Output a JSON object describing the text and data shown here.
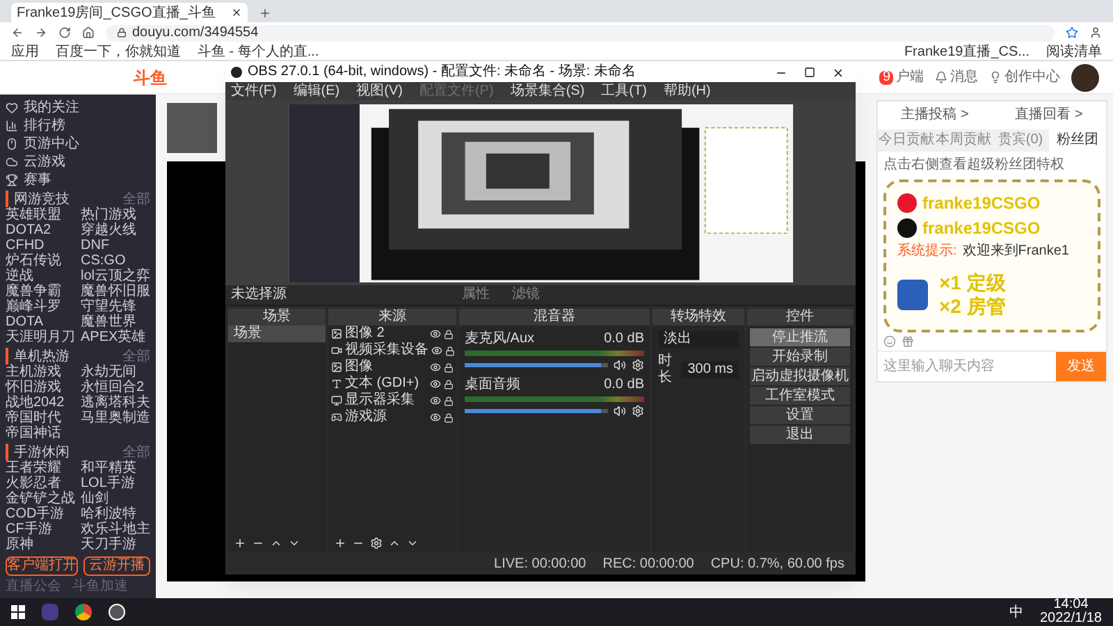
{
  "browser": {
    "tab_title": "Franke19房间_CSGO直播_斗鱼",
    "address": "douyu.com/3494554",
    "bookmarks": [
      "应用",
      "百度一下，你就知道",
      "斗鱼 - 每个人的直..."
    ],
    "bookmarks_right": [
      "Franke19直播_CS...",
      "阅读清单"
    ]
  },
  "site": {
    "logo": "斗鱼",
    "header_items": [
      "户端",
      "消息",
      "创作中心"
    ],
    "badge": "9"
  },
  "sidebar": {
    "nav": [
      {
        "label": "我的关注",
        "kind": "heart"
      },
      {
        "label": "排行榜",
        "kind": "rank"
      },
      {
        "label": "页游中心",
        "kind": "mouse"
      },
      {
        "label": "云游戏",
        "kind": "cloud"
      },
      {
        "label": "赛事",
        "kind": "trophy"
      }
    ],
    "sections": [
      {
        "title": "网游竞技",
        "more": "全部",
        "items": [
          "英雄联盟",
          "热门游戏",
          "DOTA2",
          "穿越火线",
          "CFHD",
          "DNF",
          "炉石传说",
          "CS:GO",
          "逆战",
          "lol云顶之弈",
          "魔兽争霸",
          "魔兽怀旧服",
          "巅峰斗罗",
          "守望先锋",
          "DOTA",
          "魔兽世界",
          "天涯明月刀",
          "APEX英雄"
        ]
      },
      {
        "title": "单机热游",
        "more": "全部",
        "items": [
          "主机游戏",
          "永劫无间",
          "怀旧游戏",
          "永恒回合2",
          "战地2042",
          "逃离塔科夫",
          "帝国时代",
          "马里奥制造",
          "帝国神话"
        ]
      },
      {
        "title": "手游休闲",
        "more": "全部",
        "items": [
          "王者荣耀",
          "和平精英",
          "火影忍者",
          "LOL手游",
          "金铲铲之战",
          "仙剑",
          "COD手游",
          "哈利波特",
          "CF手游",
          "欢乐斗地主",
          "原神",
          "天刀手游"
        ]
      }
    ],
    "buttons": [
      "客户端打开",
      "云游开播"
    ],
    "footer": [
      "直播公会",
      "斗鱼加速"
    ]
  },
  "obs": {
    "title": "OBS 27.0.1 (64-bit, windows) - 配置文件: 未命名 - 场景: 未命名",
    "menu": [
      {
        "label": "文件(F)",
        "disabled": false
      },
      {
        "label": "编辑(E)",
        "disabled": false
      },
      {
        "label": "视图(V)",
        "disabled": false
      },
      {
        "label": "配置文件(P)",
        "disabled": true
      },
      {
        "label": "场景集合(S)",
        "disabled": false
      },
      {
        "label": "工具(T)",
        "disabled": false
      },
      {
        "label": "帮助(H)",
        "disabled": false
      }
    ],
    "source_bar": {
      "label": "未选择源",
      "buttons": [
        "属性",
        "滤镜"
      ]
    },
    "docks": {
      "scenes": "场景",
      "sources": "来源",
      "mixer": "混音器",
      "transitions": "转场特效",
      "controls": "控件"
    },
    "scenes": [
      {
        "label": "场景",
        "selected": true
      }
    ],
    "sources": [
      {
        "label": "图像 2",
        "kind": "image"
      },
      {
        "label": "视频采集设备",
        "kind": "camera"
      },
      {
        "label": "图像",
        "kind": "image"
      },
      {
        "label": "文本 (GDI+)",
        "kind": "text"
      },
      {
        "label": "显示器采集",
        "kind": "monitor"
      },
      {
        "label": "游戏源",
        "kind": "game"
      }
    ],
    "mixer": [
      {
        "name": "麦克风/Aux",
        "reading": "0.0 dB",
        "level": 0.95
      },
      {
        "name": "桌面音频",
        "reading": "0.0 dB",
        "level": 0.95
      }
    ],
    "transition": {
      "value": "淡出",
      "duration_label": "时长",
      "duration": "300 ms"
    },
    "controls": [
      {
        "label": "停止推流",
        "active": true
      },
      {
        "label": "开始录制",
        "active": false
      },
      {
        "label": "启动虚拟摄像机",
        "active": false
      },
      {
        "label": "工作室模式",
        "active": false
      },
      {
        "label": "设置",
        "active": false
      },
      {
        "label": "退出",
        "active": false
      }
    ],
    "status": [
      "LIVE: 00:00:00",
      "REC: 00:00:00",
      "CPU: 0.7%, 60.00 fps"
    ]
  },
  "panel": {
    "links": [
      "主播投稿 >",
      "直播回看 >"
    ],
    "tabs": [
      {
        "label": "今日贡献",
        "selected": false
      },
      {
        "label": "本周贡献",
        "selected": false
      },
      {
        "label": "贵宾(0)",
        "selected": false
      },
      {
        "label": "粉丝团",
        "selected": true
      }
    ],
    "notice": "点击右侧查看超级粉丝团特权",
    "overlay": {
      "accounts": [
        "franke19CSGO",
        "franke19CSGO"
      ],
      "system": "系统提示:",
      "welcome": "欢迎来到Franke1",
      "perks": [
        "×1 定级",
        "×2 房管"
      ]
    },
    "chat_placeholder": "这里输入聊天内容",
    "send": "发送"
  },
  "taskbar": {
    "ime": "中",
    "time": "14:04",
    "date": "2022/1/18"
  }
}
